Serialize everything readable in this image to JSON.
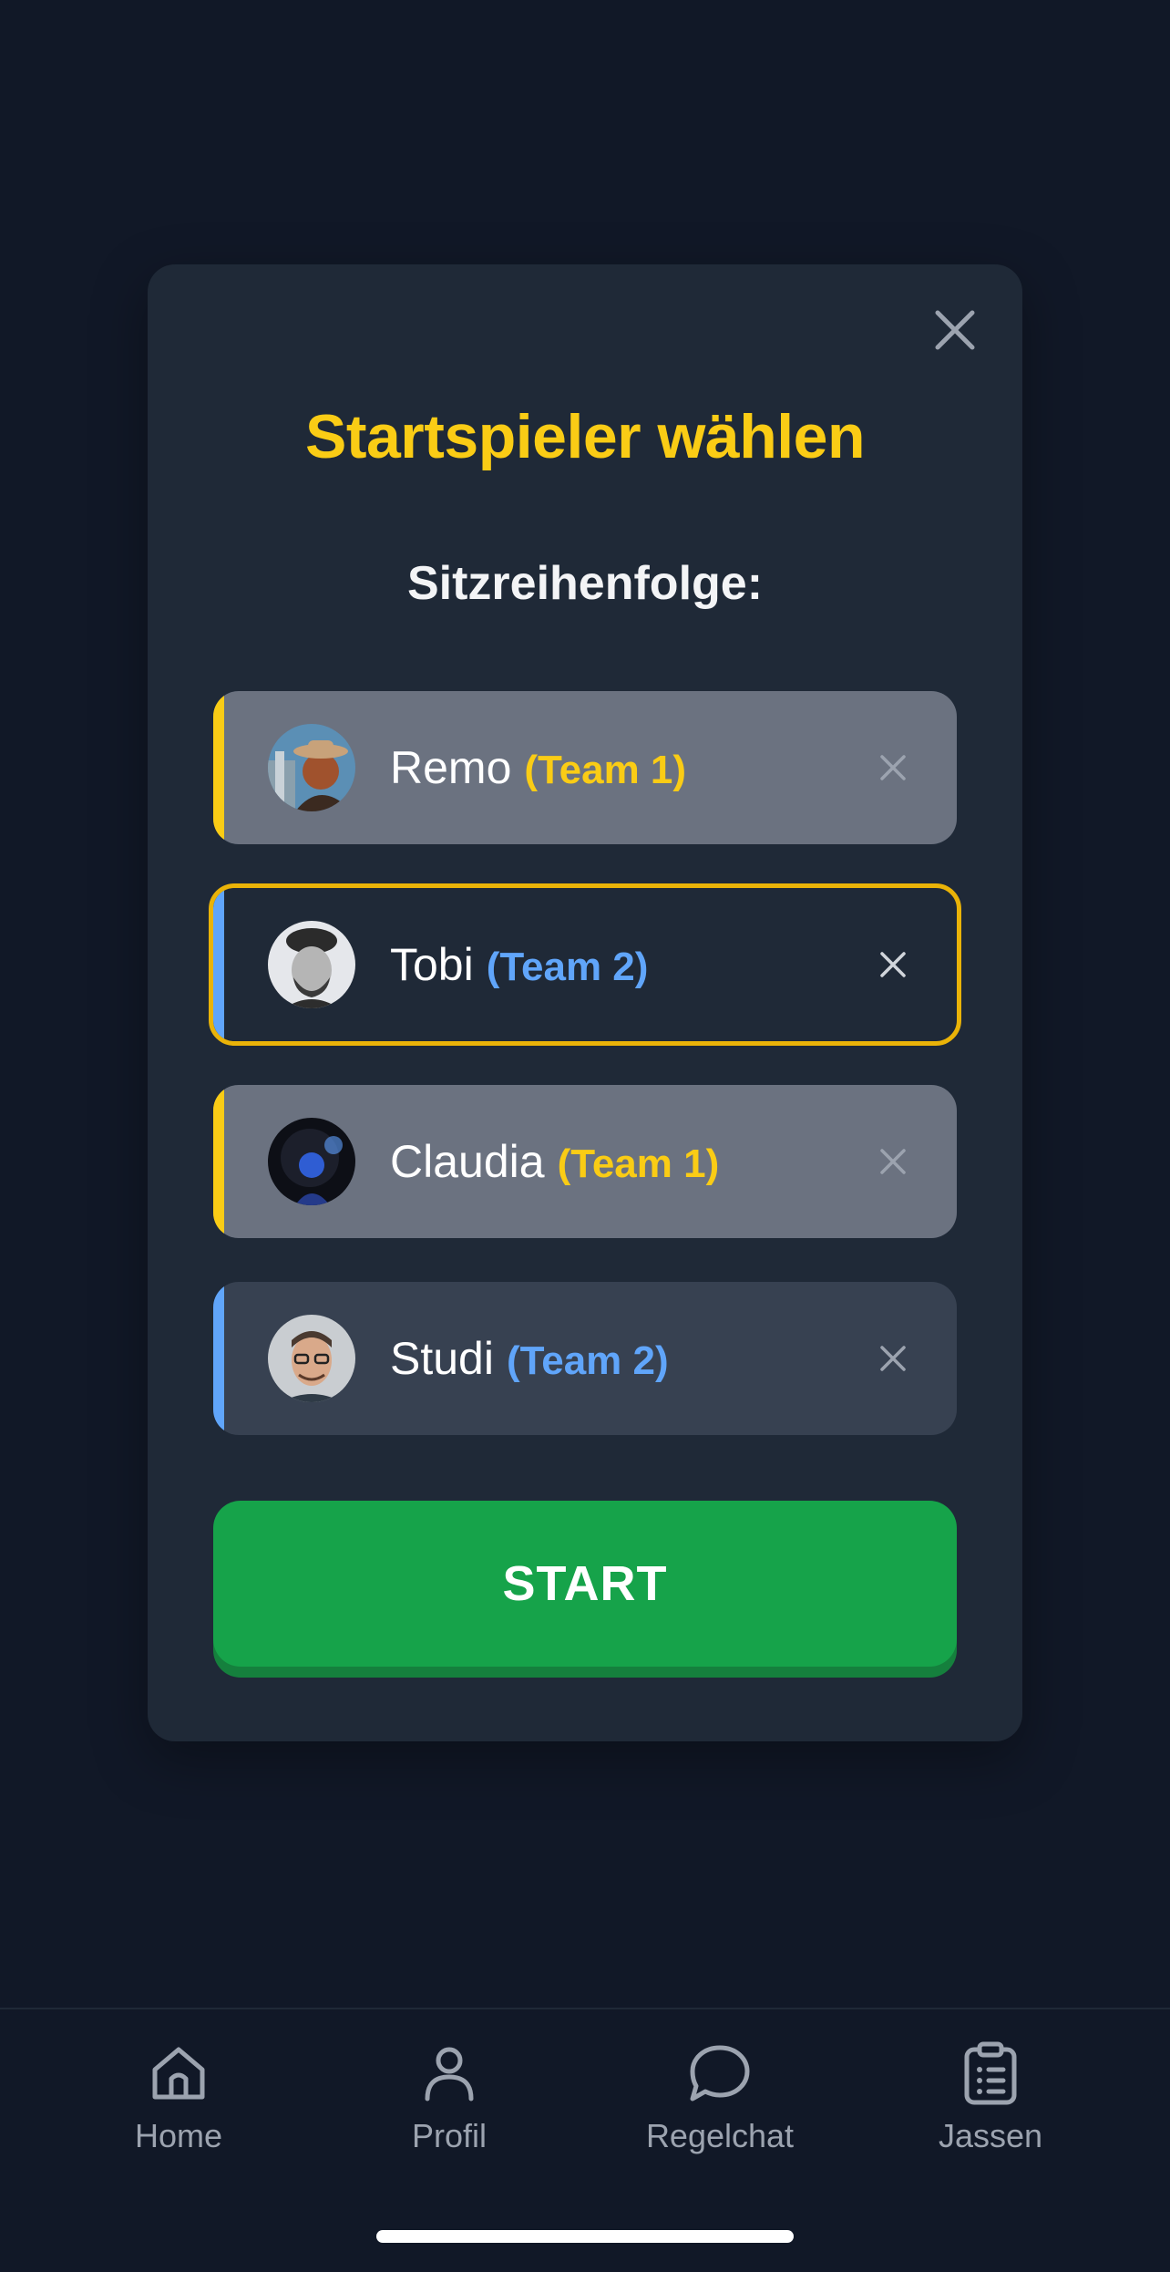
{
  "modal": {
    "title": "Startspieler wählen",
    "subtitle": "Sitzreihenfolge:",
    "start_label": "START"
  },
  "players": [
    {
      "name": "Remo",
      "team": "(Team 1)",
      "team_color": "#facc15",
      "selected": false
    },
    {
      "name": "Tobi",
      "team": "(Team 2)",
      "team_color": "#60a5fa",
      "selected": true
    },
    {
      "name": "Claudia",
      "team": "(Team 1)",
      "team_color": "#facc15",
      "selected": false
    },
    {
      "name": "Studi",
      "team": "(Team 2)",
      "team_color": "#60a5fa",
      "selected": false
    }
  ],
  "tabs": [
    {
      "label": "Home",
      "icon": "home-icon"
    },
    {
      "label": "Profil",
      "icon": "user-icon"
    },
    {
      "label": "Regelchat",
      "icon": "chat-bubble-icon"
    },
    {
      "label": "Jassen",
      "icon": "clipboard-list-icon"
    }
  ],
  "colors": {
    "background": "#111827",
    "modal": "#1f2937",
    "accent_yellow": "#facc15",
    "accent_blue": "#60a5fa",
    "start_green": "#16a34a"
  }
}
